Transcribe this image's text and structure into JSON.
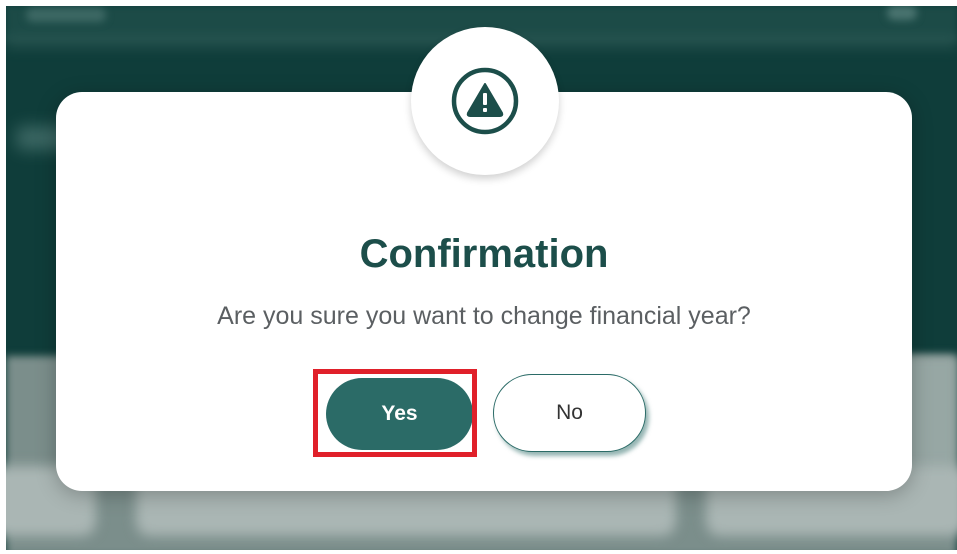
{
  "dialog": {
    "icon": "warning-triangle-icon",
    "title": "Confirmation",
    "message": "Are you sure you want to change financial year?",
    "yes_label": "Yes",
    "no_label": "No"
  },
  "colors": {
    "accent": "#2b6b67",
    "title": "#1c4e4a",
    "highlight": "#e0202a",
    "overlay": "#0f3d3a"
  }
}
